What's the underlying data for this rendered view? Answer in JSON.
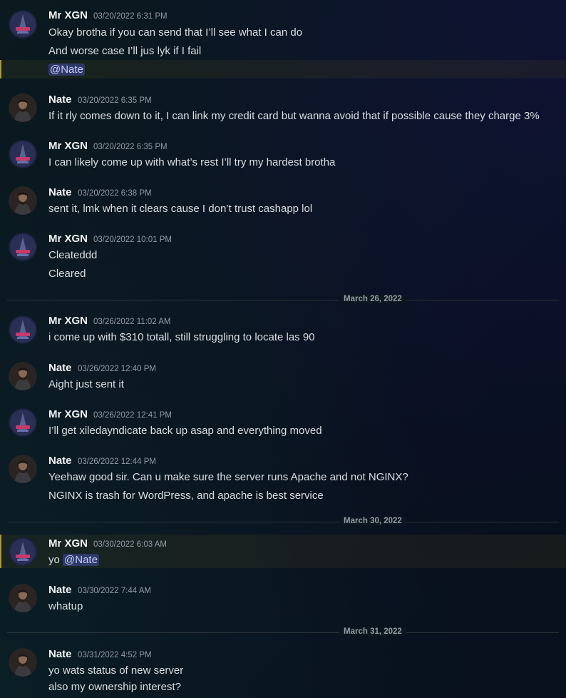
{
  "messages": [
    {
      "author": "Mr XGN",
      "timestamp": "03/20/2022 6:31 PM",
      "line1": "Okay brotha if you can send that I’ll see what I can do",
      "line2": "And worse case I’ll jus lyk if I fail",
      "mention": "@Nate"
    },
    {
      "author": "Nate",
      "timestamp": "03/20/2022 6:35 PM",
      "line1": "If it rly comes down to it, I can link my credit card but wanna avoid that if possible cause they charge 3%"
    },
    {
      "author": "Mr XGN",
      "timestamp": "03/20/2022 6:35 PM",
      "line1": "I can likely come up with what’s rest I’ll try my hardest brotha"
    },
    {
      "author": "Nate",
      "timestamp": "03/20/2022 6:38 PM",
      "line1": "sent it, lmk when it clears cause I don’t trust cashapp lol"
    },
    {
      "author": "Mr XGN",
      "timestamp": "03/20/2022 10:01 PM",
      "line1": "Cleateddd",
      "line2": "Cleared"
    },
    {
      "author": "Mr XGN",
      "timestamp": "03/26/2022 11:02 AM",
      "line1": "i come up with $310 totall, still struggling to locate las 90"
    },
    {
      "author": "Nate",
      "timestamp": "03/26/2022 12:40 PM",
      "line1": "Aight just sent it"
    },
    {
      "author": "Mr XGN",
      "timestamp": "03/26/2022 12:41 PM",
      "line1": "I’ll get xiledayndicate back up asap and everything moved"
    },
    {
      "author": "Nate",
      "timestamp": "03/26/2022 12:44 PM",
      "line1": "Yeehaw good sir.  Can u make sure the server runs Apache and not NGINX?",
      "line2": "NGINX is trash for WordPress, and apache is best service"
    },
    {
      "author": "Mr XGN",
      "timestamp": "03/30/2022 6:03 AM",
      "line1": "yo",
      "mention": "@Nate"
    },
    {
      "author": "Nate",
      "timestamp": "03/30/2022 7:44 AM",
      "line1": "whatup"
    },
    {
      "author": "Nate",
      "timestamp": "03/31/2022 4:52 PM",
      "line1": "yo wats status of new server",
      "line2": "also my ownership interest?"
    }
  ],
  "dividers": [
    "March 26, 2022",
    "March 30, 2022",
    "March 31, 2022"
  ],
  "colors": {
    "mention_bg": "#3b4190",
    "highlight": "#b5942e",
    "username": "#f2f3f5",
    "timestamp": "#949ba4"
  }
}
